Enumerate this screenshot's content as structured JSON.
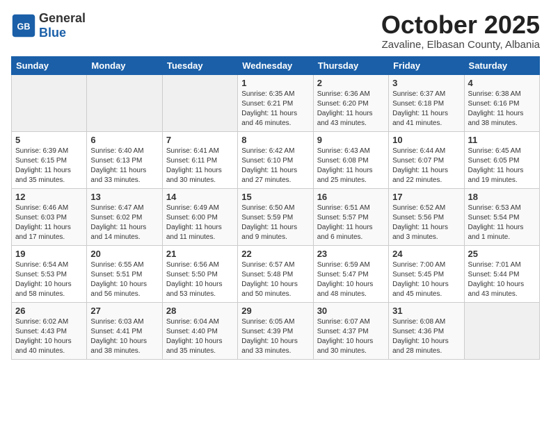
{
  "header": {
    "logo_general": "General",
    "logo_blue": "Blue",
    "month_title": "October 2025",
    "subtitle": "Zavaline, Elbasan County, Albania"
  },
  "weekdays": [
    "Sunday",
    "Monday",
    "Tuesday",
    "Wednesday",
    "Thursday",
    "Friday",
    "Saturday"
  ],
  "weeks": [
    [
      {
        "day": "",
        "info": ""
      },
      {
        "day": "",
        "info": ""
      },
      {
        "day": "",
        "info": ""
      },
      {
        "day": "1",
        "info": "Sunrise: 6:35 AM\nSunset: 6:21 PM\nDaylight: 11 hours\nand 46 minutes."
      },
      {
        "day": "2",
        "info": "Sunrise: 6:36 AM\nSunset: 6:20 PM\nDaylight: 11 hours\nand 43 minutes."
      },
      {
        "day": "3",
        "info": "Sunrise: 6:37 AM\nSunset: 6:18 PM\nDaylight: 11 hours\nand 41 minutes."
      },
      {
        "day": "4",
        "info": "Sunrise: 6:38 AM\nSunset: 6:16 PM\nDaylight: 11 hours\nand 38 minutes."
      }
    ],
    [
      {
        "day": "5",
        "info": "Sunrise: 6:39 AM\nSunset: 6:15 PM\nDaylight: 11 hours\nand 35 minutes."
      },
      {
        "day": "6",
        "info": "Sunrise: 6:40 AM\nSunset: 6:13 PM\nDaylight: 11 hours\nand 33 minutes."
      },
      {
        "day": "7",
        "info": "Sunrise: 6:41 AM\nSunset: 6:11 PM\nDaylight: 11 hours\nand 30 minutes."
      },
      {
        "day": "8",
        "info": "Sunrise: 6:42 AM\nSunset: 6:10 PM\nDaylight: 11 hours\nand 27 minutes."
      },
      {
        "day": "9",
        "info": "Sunrise: 6:43 AM\nSunset: 6:08 PM\nDaylight: 11 hours\nand 25 minutes."
      },
      {
        "day": "10",
        "info": "Sunrise: 6:44 AM\nSunset: 6:07 PM\nDaylight: 11 hours\nand 22 minutes."
      },
      {
        "day": "11",
        "info": "Sunrise: 6:45 AM\nSunset: 6:05 PM\nDaylight: 11 hours\nand 19 minutes."
      }
    ],
    [
      {
        "day": "12",
        "info": "Sunrise: 6:46 AM\nSunset: 6:03 PM\nDaylight: 11 hours\nand 17 minutes."
      },
      {
        "day": "13",
        "info": "Sunrise: 6:47 AM\nSunset: 6:02 PM\nDaylight: 11 hours\nand 14 minutes."
      },
      {
        "day": "14",
        "info": "Sunrise: 6:49 AM\nSunset: 6:00 PM\nDaylight: 11 hours\nand 11 minutes."
      },
      {
        "day": "15",
        "info": "Sunrise: 6:50 AM\nSunset: 5:59 PM\nDaylight: 11 hours\nand 9 minutes."
      },
      {
        "day": "16",
        "info": "Sunrise: 6:51 AM\nSunset: 5:57 PM\nDaylight: 11 hours\nand 6 minutes."
      },
      {
        "day": "17",
        "info": "Sunrise: 6:52 AM\nSunset: 5:56 PM\nDaylight: 11 hours\nand 3 minutes."
      },
      {
        "day": "18",
        "info": "Sunrise: 6:53 AM\nSunset: 5:54 PM\nDaylight: 11 hours\nand 1 minute."
      }
    ],
    [
      {
        "day": "19",
        "info": "Sunrise: 6:54 AM\nSunset: 5:53 PM\nDaylight: 10 hours\nand 58 minutes."
      },
      {
        "day": "20",
        "info": "Sunrise: 6:55 AM\nSunset: 5:51 PM\nDaylight: 10 hours\nand 56 minutes."
      },
      {
        "day": "21",
        "info": "Sunrise: 6:56 AM\nSunset: 5:50 PM\nDaylight: 10 hours\nand 53 minutes."
      },
      {
        "day": "22",
        "info": "Sunrise: 6:57 AM\nSunset: 5:48 PM\nDaylight: 10 hours\nand 50 minutes."
      },
      {
        "day": "23",
        "info": "Sunrise: 6:59 AM\nSunset: 5:47 PM\nDaylight: 10 hours\nand 48 minutes."
      },
      {
        "day": "24",
        "info": "Sunrise: 7:00 AM\nSunset: 5:45 PM\nDaylight: 10 hours\nand 45 minutes."
      },
      {
        "day": "25",
        "info": "Sunrise: 7:01 AM\nSunset: 5:44 PM\nDaylight: 10 hours\nand 43 minutes."
      }
    ],
    [
      {
        "day": "26",
        "info": "Sunrise: 6:02 AM\nSunset: 4:43 PM\nDaylight: 10 hours\nand 40 minutes."
      },
      {
        "day": "27",
        "info": "Sunrise: 6:03 AM\nSunset: 4:41 PM\nDaylight: 10 hours\nand 38 minutes."
      },
      {
        "day": "28",
        "info": "Sunrise: 6:04 AM\nSunset: 4:40 PM\nDaylight: 10 hours\nand 35 minutes."
      },
      {
        "day": "29",
        "info": "Sunrise: 6:05 AM\nSunset: 4:39 PM\nDaylight: 10 hours\nand 33 minutes."
      },
      {
        "day": "30",
        "info": "Sunrise: 6:07 AM\nSunset: 4:37 PM\nDaylight: 10 hours\nand 30 minutes."
      },
      {
        "day": "31",
        "info": "Sunrise: 6:08 AM\nSunset: 4:36 PM\nDaylight: 10 hours\nand 28 minutes."
      },
      {
        "day": "",
        "info": ""
      }
    ]
  ]
}
